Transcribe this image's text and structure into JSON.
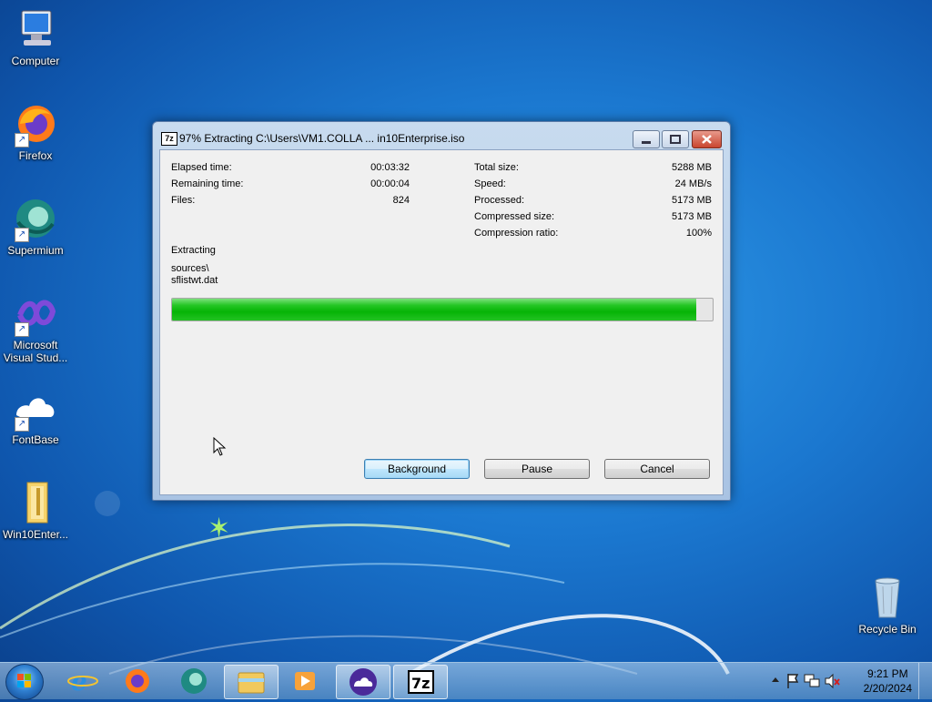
{
  "desktop": {
    "icons": [
      {
        "label": "Computer",
        "icon": "computer-icon"
      },
      {
        "label": "Firefox",
        "icon": "firefox-icon"
      },
      {
        "label": "Supermium",
        "icon": "supermium-icon"
      },
      {
        "label": "Microsoft Visual Stud...",
        "icon": "visual-studio-icon"
      },
      {
        "label": "FontBase",
        "icon": "fontbase-icon"
      },
      {
        "label": "Win10Enter...",
        "icon": "folder-icon"
      },
      {
        "label": "Recycle Bin",
        "icon": "recycle-bin-icon"
      }
    ]
  },
  "window": {
    "title": "97% Extracting C:\\Users\\VM1.COLLA ... in10Enterprise.iso",
    "app_icon_text": "7z",
    "left_stats": [
      {
        "label": "Elapsed time:",
        "value": "00:03:32"
      },
      {
        "label": "Remaining time:",
        "value": "00:00:04"
      },
      {
        "label": "Files:",
        "value": "824"
      }
    ],
    "right_stats": [
      {
        "label": "Total size:",
        "value": "5288 MB"
      },
      {
        "label": "Speed:",
        "value": "24 MB/s"
      },
      {
        "label": "Processed:",
        "value": "5173 MB"
      },
      {
        "label": "Compressed size:",
        "value": "5173 MB"
      },
      {
        "label": "Compression ratio:",
        "value": "100%"
      }
    ],
    "operation": "Extracting",
    "current_path": "sources\\",
    "current_file": "sflistwt.dat",
    "progress_fraction": 0.97,
    "buttons": {
      "background": "Background",
      "pause": "Pause",
      "cancel": "Cancel"
    }
  },
  "taskbar": {
    "apps": [
      "internet-explorer-icon",
      "firefox-icon",
      "supermium-icon",
      "file-explorer-icon",
      "media-player-icon",
      "fontbase-icon",
      "7zip-icon"
    ],
    "time": "9:21 PM",
    "date": "2/20/2024"
  },
  "colors": {
    "progress": "#06b406",
    "desktop": "#1b78d0"
  }
}
